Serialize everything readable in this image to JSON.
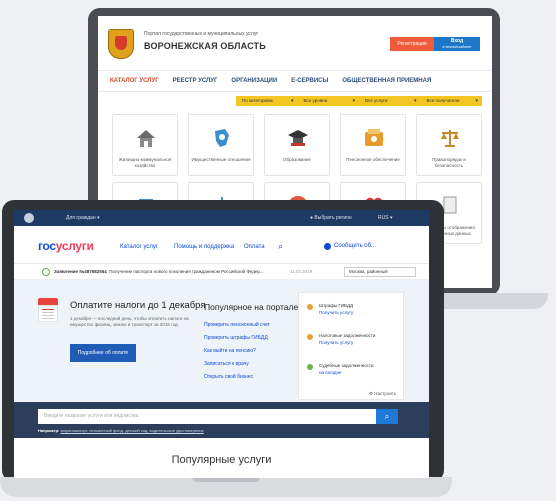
{
  "back": {
    "portal_caption": "Портал государственных и муниципальных услуг",
    "region": "ВОРОНЕЖСКАЯ ОБЛАСТЬ",
    "register": "Регистрация",
    "login": "Вход",
    "login_sub": "в личный кабинет",
    "nav": [
      "КАТАЛОГ УСЛУГ",
      "РЕЕСТР УСЛУГ",
      "ОРГАНИЗАЦИИ",
      "Е-СЕРВИСЫ",
      "ОБЩЕСТВЕННАЯ ПРИЕМНАЯ"
    ],
    "filters": [
      "По категориям",
      "Все уровни",
      "Все услуги",
      "Все получатели"
    ],
    "tiles": [
      {
        "label": "Жилищно-коммунальное хозяйство",
        "icon": "house-icon",
        "color": "#6b6b6b"
      },
      {
        "label": "Имущественные отношения",
        "icon": "map-pin-icon",
        "color": "#3a8fd1"
      },
      {
        "label": "Образование",
        "icon": "graduation-cap-icon",
        "color": "#333333"
      },
      {
        "label": "Пенсионное обеспечение",
        "icon": "pension-icon",
        "color": "#e89a2a"
      },
      {
        "label": "Правопорядок и безопасность",
        "icon": "scales-icon",
        "color": "#c8892a"
      },
      {
        "label": "",
        "icon": "tile-icon",
        "color": "#3a8fd1"
      },
      {
        "label": "",
        "icon": "snowflake-icon",
        "color": "#3a8fd1"
      },
      {
        "label": "",
        "icon": "lifebuoy-icon",
        "color": "#e0573f"
      },
      {
        "label": "",
        "icon": "heart-icon",
        "color": "#d93a3a"
      },
      {
        "label": "Стандарты отображения электронных данных",
        "icon": "document-icon",
        "color": "#999999"
      }
    ]
  },
  "front": {
    "top": {
      "for_citizens": "Для граждан",
      "region": "Выбрать регион",
      "lang": "RUS"
    },
    "logo_a": "гос",
    "logo_b": "услуги",
    "nav": [
      "Каталог услуг",
      "Помощь и поддержка",
      "Оплата"
    ],
    "sober": "Сообщить об...",
    "notice": {
      "bold": "Заявление №487682564",
      "text": "Получение паспорта нового поколения гражданином Российской Федер...",
      "date": "11.03.2019",
      "location": "Москва, районный"
    },
    "tax": {
      "title": "Оплатите налоги до 1 декабря",
      "desc": "1 декабря — последний день, чтобы оплатить налоги на имущество физлиц, землю и транспорт за 2015 год",
      "button": "Подробнее об оплате"
    },
    "popular_portal": {
      "title": "Популярное на портале",
      "links": [
        "Проверить пенсионный счет",
        "Проверить штрафы ГИБДД",
        "Как выйти на пенсию?",
        "Записаться к врачу",
        "Открыть свой бизнес"
      ]
    },
    "side": [
      {
        "title": "Штрафы ГИБДД",
        "sub": "Получить услугу",
        "color": "#e8a23a"
      },
      {
        "title": "Налоговые задолженности",
        "sub": "Получить услугу",
        "color": "#e8a23a"
      },
      {
        "title": "Судебные задолженности",
        "sub": "на сегодня",
        "color": "#6ab04c"
      }
    ],
    "side_settings": "Настроить",
    "search": {
      "placeholder": "Введите название услуги или ведомства",
      "example_label": "Например:",
      "example_text": "загранпаспорт, пенсионный фонд, детский сад, водительское удостоверение"
    },
    "popular_services": "Популярные услуги"
  }
}
